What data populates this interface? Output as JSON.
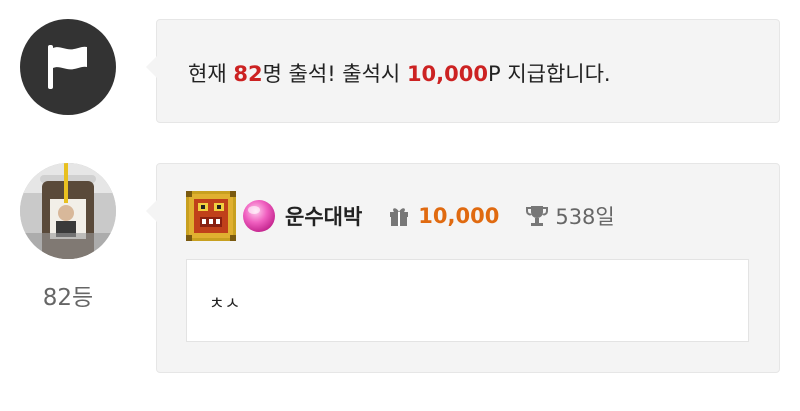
{
  "notice": {
    "icon": "flag-icon",
    "text_before": "현재 ",
    "count": "82",
    "text_middle": "명 출석! 출석시 ",
    "reward": "10,000",
    "text_after": "P 지급합니다.",
    "highlight_color": "#cc2222"
  },
  "post": {
    "rank": "82등",
    "username": "운수대박",
    "points": "10,000",
    "days": "538일",
    "comment": "ㅊㅅ",
    "points_color": "#e06a10"
  }
}
